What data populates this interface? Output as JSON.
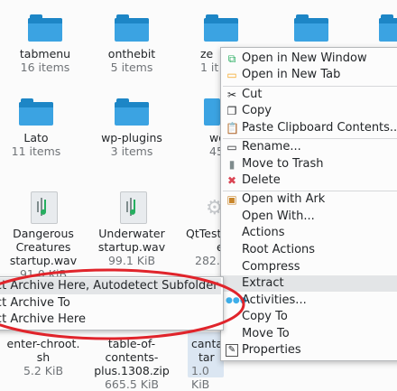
{
  "files": [
    {
      "name": "tabmenu",
      "info": "16 items"
    },
    {
      "name": "onthebit",
      "info": "5 items"
    },
    {
      "name": "ze",
      "info": "1 it"
    },
    {
      "name": "Lato",
      "info": "11 items"
    },
    {
      "name": "wp-plugins",
      "info": "3 items"
    },
    {
      "name": "wo",
      "info": "45 it"
    },
    {
      "name_lines": [
        "Dangerous",
        "Creatures",
        "startup.wav"
      ],
      "info": "91.0 KiB"
    },
    {
      "name_lines": [
        "Underwater",
        "startup.wav"
      ],
      "info": "99.1 KiB"
    },
    {
      "name_lines": [
        "QtTest",
        "e"
      ],
      "info": "282.5"
    },
    {
      "name_lines": [
        "enter-chroot.",
        "sh"
      ],
      "info": "5.2 KiB"
    },
    {
      "name_lines": [
        "table-of-",
        "contents-",
        "plus.1308.zip"
      ],
      "info": "665.5 KiB"
    },
    {
      "name_lines": [
        "canta",
        "tar"
      ],
      "info": "1.0 KiB"
    }
  ],
  "context_menu": {
    "items": [
      {
        "label": "Open in New Window",
        "icon": "new-window-icon"
      },
      {
        "label": "Open in New Tab",
        "icon": "new-tab-icon"
      },
      {
        "label": "Cut",
        "icon": "scissors-icon"
      },
      {
        "label": "Copy",
        "icon": "copy-icon"
      },
      {
        "label": "Paste Clipboard Contents...",
        "icon": "paste-icon"
      },
      {
        "label": "Rename...",
        "icon": "rename-icon"
      },
      {
        "label": "Move to Trash",
        "icon": "trash-icon"
      },
      {
        "label": "Delete",
        "icon": "delete-icon"
      },
      {
        "label": "Open with Ark",
        "icon": "ark-icon"
      },
      {
        "label": "Open With...",
        "icon": ""
      },
      {
        "label": "Actions",
        "icon": ""
      },
      {
        "label": "Root Actions",
        "icon": ""
      },
      {
        "label": "Compress",
        "icon": ""
      },
      {
        "label": "Extract",
        "icon": ""
      },
      {
        "label": "Activities...",
        "icon": "activities-icon"
      },
      {
        "label": "Copy To",
        "icon": ""
      },
      {
        "label": "Move To",
        "icon": ""
      },
      {
        "label": "Properties",
        "icon": "properties-icon"
      }
    ]
  },
  "extract_submenu": {
    "items": [
      {
        "label": "ct Archive Here, Autodetect Subfolder"
      },
      {
        "label": "ct Archive To"
      },
      {
        "label": "ct Archive Here"
      }
    ]
  },
  "colors": {
    "folder": "#3ba3e2",
    "highlight_ring": "#e0242b",
    "delete_icon": "#da4453"
  }
}
